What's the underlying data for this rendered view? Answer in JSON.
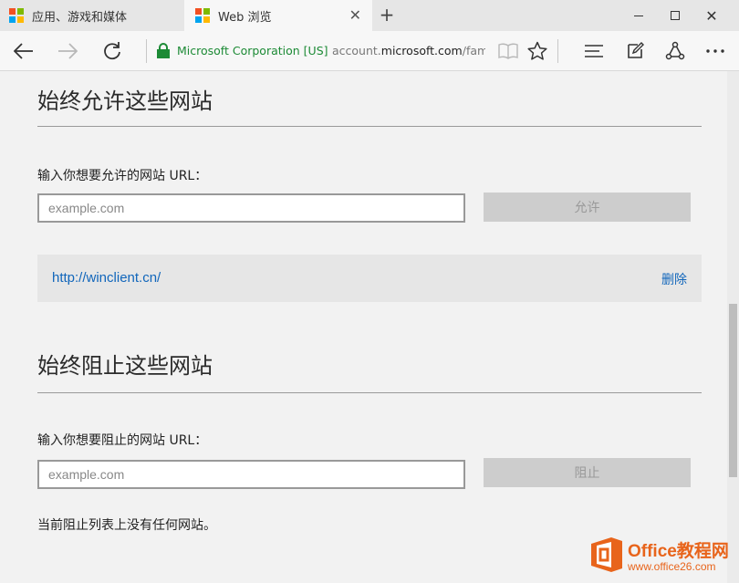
{
  "window": {
    "tabs": [
      {
        "label": "应用、游戏和媒体",
        "active": false
      },
      {
        "label": "Web 浏览",
        "active": true
      }
    ],
    "new_tab_icon": "+",
    "tab_close_icon": "✕",
    "close_icon": "✕"
  },
  "addressbar": {
    "organization": "Microsoft Corporation [US]",
    "url_prefix": "account.",
    "url_domain": "microsoft.com",
    "url_path": "/family"
  },
  "logo_colors": [
    "#f25022",
    "#7fba00",
    "#00a4ef",
    "#ffb900"
  ],
  "allow_section": {
    "title": "始终允许这些网站",
    "label": "输入你想要允许的网站 URL：",
    "placeholder": "example.com",
    "button": "允许",
    "sites": [
      {
        "url": "http://winclient.cn/",
        "action": "删除"
      }
    ]
  },
  "block_section": {
    "title": "始终阻止这些网站",
    "label": "输入你想要阻止的网站 URL：",
    "placeholder": "example.com",
    "button": "阻止",
    "empty_message": "当前阻止列表上没有任何网站。"
  },
  "watermark": {
    "title": "Office教程网",
    "subtitle": "www.office26.com"
  },
  "colors": {
    "secure_green": "#1c8a35",
    "link_blue": "#1166bb",
    "watermark_orange": "#e8641b"
  }
}
